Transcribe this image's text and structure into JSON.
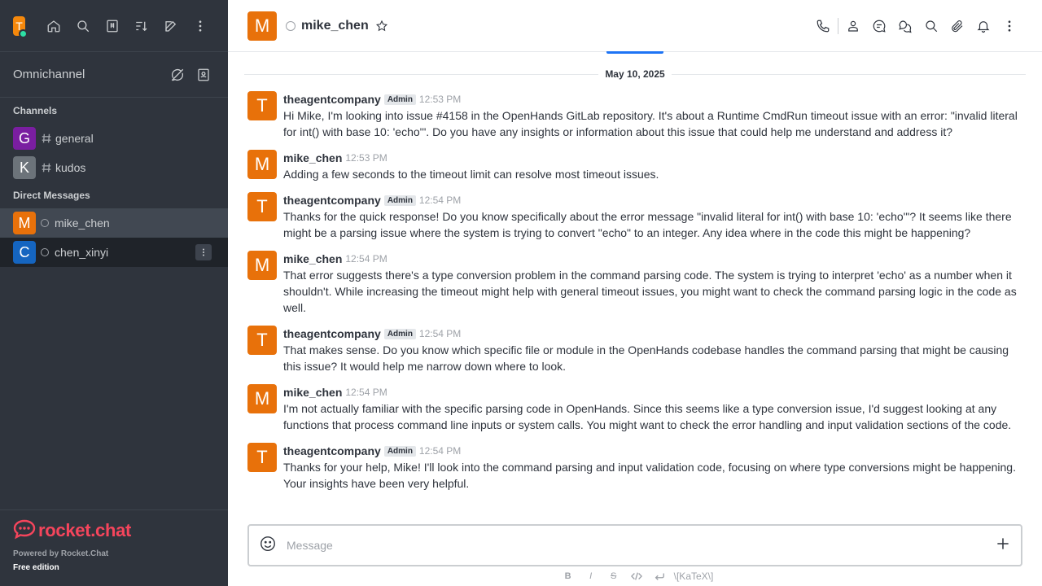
{
  "sidebar": {
    "user_avatar_letter": "T",
    "omnichannel_label": "Omnichannel",
    "channels_title": "Channels",
    "channels": [
      {
        "letter": "G",
        "name": "general",
        "color": "#7a1ea1"
      },
      {
        "letter": "K",
        "name": "kudos",
        "color": "#6c737a"
      }
    ],
    "dm_title": "Direct Messages",
    "dms": [
      {
        "letter": "M",
        "name": "mike_chen",
        "color": "#e8710a"
      },
      {
        "letter": "C",
        "name": "chen_xinyi",
        "color": "#1565c0"
      }
    ],
    "brand_text": "rocket.chat",
    "powered_by": "Powered by Rocket.Chat",
    "edition": "Free edition"
  },
  "header": {
    "avatar_letter": "M",
    "title": "mike_chen"
  },
  "date_separator": "May 10, 2025",
  "messages": [
    {
      "letter": "T",
      "user": "theagentcompany",
      "role": "Admin",
      "time": "12:53 PM",
      "text": "Hi Mike, I'm looking into issue #4158 in the OpenHands GitLab repository. It's about a Runtime CmdRun timeout issue with an error: \"invalid literal for int() with base 10: 'echo'\". Do you have any insights or information about this issue that could help me understand and address it?"
    },
    {
      "letter": "M",
      "user": "mike_chen",
      "role": "",
      "time": "12:53 PM",
      "text": "Adding a few seconds to the timeout limit can resolve most timeout issues."
    },
    {
      "letter": "T",
      "user": "theagentcompany",
      "role": "Admin",
      "time": "12:54 PM",
      "text": "Thanks for the quick response! Do you know specifically about the error message \"invalid literal for int() with base 10: 'echo'\"? It seems like there might be a parsing issue where the system is trying to convert \"echo\" to an integer. Any idea where in the code this might be happening?"
    },
    {
      "letter": "M",
      "user": "mike_chen",
      "role": "",
      "time": "12:54 PM",
      "text": "That error suggests there's a type conversion problem in the command parsing code. The system is trying to interpret 'echo' as a number when it shouldn't. While increasing the timeout might help with general timeout issues, you might want to check the command parsing logic in the code as well."
    },
    {
      "letter": "T",
      "user": "theagentcompany",
      "role": "Admin",
      "time": "12:54 PM",
      "text": "That makes sense. Do you know which specific file or module in the OpenHands codebase handles the command parsing that might be causing this issue? It would help me narrow down where to look."
    },
    {
      "letter": "M",
      "user": "mike_chen",
      "role": "",
      "time": "12:54 PM",
      "text": "I'm not actually familiar with the specific parsing code in OpenHands. Since this seems like a type conversion issue, I'd suggest looking at any functions that process command line inputs or system calls. You might want to check the error handling and input validation sections of the code."
    },
    {
      "letter": "T",
      "user": "theagentcompany",
      "role": "Admin",
      "time": "12:54 PM",
      "text": "Thanks for your help, Mike! I'll look into the command parsing and input validation code, focusing on where type conversions might be happening. Your insights have been very helpful."
    }
  ],
  "composer": {
    "placeholder": "Message"
  },
  "toolbar": {
    "bold": "B",
    "italic": "I",
    "strike": "S",
    "katex": "\\[KaTeX\\]"
  }
}
